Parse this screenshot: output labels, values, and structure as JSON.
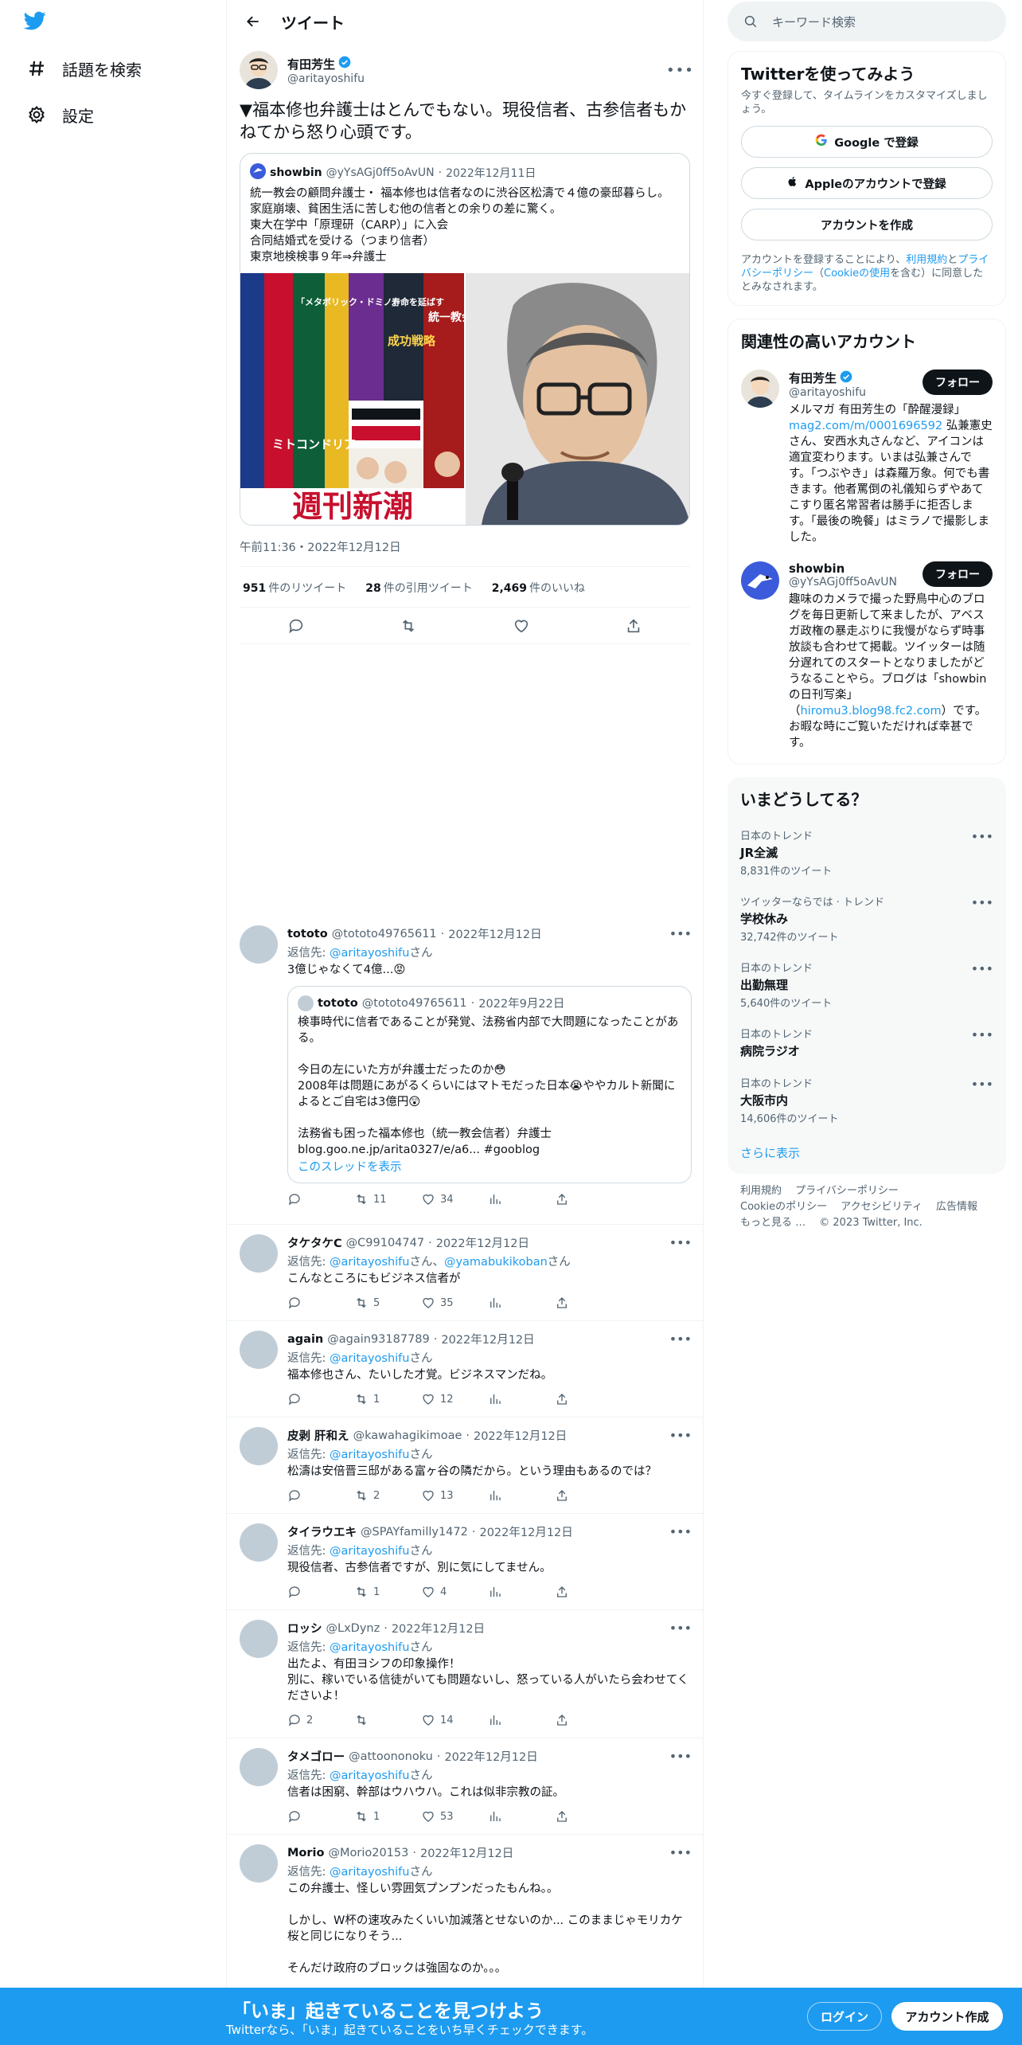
{
  "nav": {
    "explore_label": "話題を検索",
    "settings_label": "設定"
  },
  "header": {
    "title": "ツイート"
  },
  "main_tweet": {
    "author_name": "有田芳生",
    "author_handle": "@aritayoshifu",
    "text": "▼福本修也弁護士はとんでもない。現役信者、古参信者もかねてから怒り心頭です。",
    "quote": {
      "author_name": "showbin",
      "author_handle": "@yYsAGj0ff5oAvUN",
      "date": "2022年12月11日",
      "text": "統一教会の顧問弁護士・ 福本修也は信者なのに渋谷区松濤で４億の豪邸暮らし。\n家庭崩壊、貧困生活に苦しむ他の信者との余りの差に驚く。\n東大在学中「原理研（CARP）」に入会\n合同結婚式を受ける（つまり信者）\n東京地検検事９年⇒弁護士",
      "magazine_title": "週刊新潮",
      "magazine_lines": [
        "「メタボリック・ドミノ」",
        "寿命を延ばす",
        "成功戦略",
        "ミトコンドリア",
        "統一教会"
      ]
    },
    "timestamp": "午前11:36・2022年12月12日",
    "retweets": "951",
    "retweets_label": "件のリツイート",
    "quotes": "28",
    "quotes_label": "件の引用ツイート",
    "likes": "2,469",
    "likes_label": "件のいいね"
  },
  "replies": [
    {
      "name": "tototo",
      "handle": "@tototo49765611",
      "date": "2022年12月12日",
      "to_prefix": "返信先: ",
      "to": "@aritayoshifu",
      "to_suffix": "さん",
      "text": "3億じゃなくて4億...😡",
      "quote": {
        "name": "tototo",
        "handle": "@tototo49765611",
        "date": "2022年9月22日",
        "text": "検事時代に信者であることが発覚、法務省内部で大問題になったことがある。\n\n今日の左にいた方が弁護士だったのか😳\n2008年は問題にあがるくらいにはマトモだった日本😭ややカルト新聞によるとご自宅は3億円😲\n\n法務省も困った福本修也（統一教会信者）弁護士\nblog.goo.ne.jp/arita0327/e/a6... #gooblog",
        "thread_link": "このスレッドを表示"
      },
      "replies_count": "",
      "retweets_count": "11",
      "likes_count": "34"
    },
    {
      "name": "タケタケC",
      "handle": "@C99104747",
      "date": "2022年12月12日",
      "to_prefix": "返信先: ",
      "to": "@aritayoshifu",
      "to_mid": "さん、",
      "to2": "@yamabukikoban",
      "to_suffix": "さん",
      "text": "こんなところにもビジネス信者が",
      "replies_count": "",
      "retweets_count": "5",
      "likes_count": "35"
    },
    {
      "name": "again",
      "handle": "@again93187789",
      "date": "2022年12月12日",
      "to_prefix": "返信先: ",
      "to": "@aritayoshifu",
      "to_suffix": "さん",
      "text": "福本修也さん、たいした才覚。ビジネスマンだね。",
      "replies_count": "",
      "retweets_count": "1",
      "likes_count": "12"
    },
    {
      "name": "皮剥 肝和え",
      "handle": "@kawahagikimoae",
      "date": "2022年12月12日",
      "to_prefix": "返信先: ",
      "to": "@aritayoshifu",
      "to_suffix": "さん",
      "text": "松濤は安倍晋三邸がある富ヶ谷の隣だから。という理由もあるのでは？",
      "replies_count": "",
      "retweets_count": "2",
      "likes_count": "13"
    },
    {
      "name": "タイラウエキ",
      "handle": "@SPAYfamilly1472",
      "date": "2022年12月12日",
      "to_prefix": "返信先: ",
      "to": "@aritayoshifu",
      "to_suffix": "さん",
      "text": "現役信者、古参信者ですが、別に気にしてません。",
      "replies_count": "",
      "retweets_count": "1",
      "likes_count": "4"
    },
    {
      "name": "ロッシ",
      "handle": "@LxDynz",
      "date": "2022年12月12日",
      "to_prefix": "返信先: ",
      "to": "@aritayoshifu",
      "to_suffix": "さん",
      "text": "出たよ、有田ヨシフの印象操作！\n別に、稼いでいる信徒がいても問題ないし、怒っている人がいたら会わせてくださいよ！",
      "replies_count": "2",
      "retweets_count": "",
      "likes_count": "14"
    },
    {
      "name": "タメゴロー",
      "handle": "@attoononoku",
      "date": "2022年12月12日",
      "to_prefix": "返信先: ",
      "to": "@aritayoshifu",
      "to_suffix": "さん",
      "text": "信者は困窮、幹部はウハウハ。これは似非宗教の証。",
      "replies_count": "",
      "retweets_count": "1",
      "likes_count": "53"
    },
    {
      "name": "Morio",
      "handle": "@Morio20153",
      "date": "2022年12月12日",
      "to_prefix": "返信先: ",
      "to": "@aritayoshifu",
      "to_suffix": "さん",
      "text": "この弁護士、怪しい雰囲気プンプンだったもんね。。\n\nしかし、W杯の速攻みたくいい加減落とせないのか... このままじゃモリカケ桜と同じになりそう...\n\nそんだけ政府のブロックは強固なのか。。。",
      "replies_count": "",
      "retweets_count": "",
      "likes_count": ""
    }
  ],
  "search": {
    "placeholder": "キーワード検索"
  },
  "signup_panel": {
    "title": "Twitterを使ってみよう",
    "subtitle": "今すぐ登録して、タイムラインをカスタマイズしましょう。",
    "google_label": "Google で登録",
    "apple_label": "Appleのアカウントで登録",
    "create_label": "アカウントを作成",
    "terms_prefix": "アカウントを登録することにより、",
    "terms_link1": "利用規約",
    "terms_and": "と",
    "terms_link2": "プライバシーポリシー",
    "terms_paren_open": "（",
    "terms_link3": "Cookieの使用",
    "terms_suffix": "を含む）に同意したとみなされます。"
  },
  "related_panel": {
    "title": "関連性の高いアカウント",
    "accounts": [
      {
        "name": "有田芳生",
        "handle": "@aritayoshifu",
        "follow_label": "フォロー",
        "bio_pre": "メルマガ 有田芳生の「酔醒漫録」",
        "bio_link": "mag2.com/m/0001696592",
        "bio_post": " 弘兼憲史さん、安西水丸さんなど、アイコンは適宜変わります。いまは弘兼さんです。「つぶやき」は森羅万象。何でも書きます。他者罵倒の礼儀知らずやあてこすり匿名常習者は勝手に拒否します。「最後の晩餐」はミラノで撮影しました。"
      },
      {
        "name": "showbin",
        "handle": "@yYsAGj0ff5oAvUN",
        "follow_label": "フォロー",
        "bio_pre": "趣味のカメラで撮った野鳥中心のブログを毎日更新して来ましたが、アベスガ政権の暴走ぶりに我慢がならず時事放談も合わせて掲載。ツイッターは随分遅れてのスタートとなりましたがどうなることやら。ブログは「showbinの日刊写楽」（",
        "bio_link": "hiromu3.blog98.fc2.com",
        "bio_post": "）です。お暇な時にご覧いただければ幸甚です。"
      }
    ]
  },
  "trends_panel": {
    "title": "いまどうしてる？",
    "items": [
      {
        "context": "日本のトレンド",
        "name": "JR全滅",
        "count": "8,831件のツイート"
      },
      {
        "context": "ツイッターならでは · トレンド",
        "name": "学校休み",
        "count": "32,742件のツイート"
      },
      {
        "context": "日本のトレンド",
        "name": "出勤無理",
        "count": "5,640件のツイート"
      },
      {
        "context": "日本のトレンド",
        "name": "病院ラジオ",
        "count": ""
      },
      {
        "context": "日本のトレンド",
        "name": "大阪市内",
        "count": "14,606件のツイート"
      }
    ],
    "show_more": "さらに表示"
  },
  "footer": {
    "links": [
      "利用規約",
      "プライバシーポリシー",
      "Cookieのポリシー",
      "アクセシビリティ",
      "広告情報",
      "もっと見る …"
    ],
    "copyright": "© 2023 Twitter, Inc."
  },
  "bottom_bar": {
    "headline": "「いま」起きていることを見つけよう",
    "subline": "Twitterなら、「いま」起きていることをいち早くチェックできます。",
    "login_label": "ログイン",
    "signup_label": "アカウント作成"
  },
  "colors": {
    "accent": "#1d9bf0",
    "text": "#0f1419",
    "muted": "#536471",
    "border": "#eff3f4"
  }
}
